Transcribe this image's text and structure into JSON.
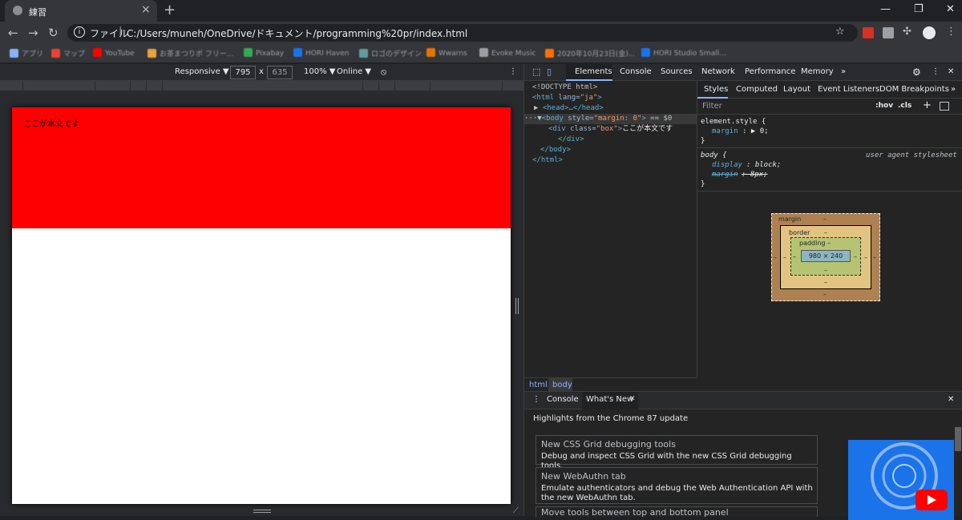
{
  "browser": {
    "tab_title": "練習",
    "new_tab": "+",
    "win_min": "—",
    "win_max": "❐",
    "win_close": "✕",
    "url_scheme": "ファイル",
    "url_separator": "|",
    "url": "C:/Users/muneh/OneDrive/ドキュメント/programming%20pr/index.html",
    "bookmarks": [
      {
        "label": "アプリ",
        "color": "#8ab4f8"
      },
      {
        "label": "マップ",
        "color": "#ea4335"
      },
      {
        "label": "YouTube",
        "color": "#ff0000"
      },
      {
        "label": "お茶まつりボ フリー...",
        "color": "#e8a33d"
      },
      {
        "label": "Pixabay",
        "color": "#34a853"
      },
      {
        "label": "HORI Haven",
        "color": "#1a73e8"
      },
      {
        "label": "ロゴのデザイン",
        "color": "#5f9ea0"
      },
      {
        "label": "Wwarns",
        "color": "#e37400"
      },
      {
        "label": "Evoke Music",
        "color": "#9aa0a6"
      },
      {
        "label": "2020年10月23日(金)...",
        "color": "#ff6d00"
      },
      {
        "label": "HORI Studio Small...",
        "color": "#1a73e8"
      }
    ]
  },
  "device_toolbar": {
    "device": "Responsive ▼",
    "width": "795",
    "x": "x",
    "height": "635",
    "zoom": "100% ▼",
    "network": "Online ▼"
  },
  "page": {
    "box_text": "ここが本文です",
    "box_color": "#ff0000"
  },
  "devtools": {
    "tabs": [
      "Elements",
      "Console",
      "Sources",
      "Network",
      "Performance",
      "Memory",
      "»"
    ],
    "dom": {
      "doctype": "<!DOCTYPE html>",
      "html_open_tag": "<html",
      "html_lang_attr": "lang=",
      "html_lang_val": "\"ja\"",
      "html_open_close": ">",
      "head": "<head>…</head>",
      "body_tag": "<body",
      "body_attr": "style=",
      "body_val": "\"margin: 0\"",
      "body_close": ">",
      "body_eq": "== $0",
      "div_tag": "<div",
      "div_attr": "class=",
      "div_val": "\"box\"",
      "div_close": ">",
      "div_text": "ここが本文です",
      "div_end": "</div>",
      "body_end": "</body>",
      "html_end": "</html>"
    },
    "breadcrumbs": [
      "html",
      "body"
    ],
    "style_tabs": [
      "Styles",
      "Computed",
      "Layout",
      "Event Listeners",
      "DOM Breakpoints",
      "»"
    ],
    "filter_placeholder": "Filter",
    "hov": ":hov",
    "cls": ".cls",
    "plus": "+",
    "rule1": {
      "selector": "element.style {",
      "prop": "margin",
      "value": "0;",
      "close": "}"
    },
    "rule2": {
      "selector": "body {",
      "source": "user agent stylesheet",
      "prop1": "display",
      "val1": "block;",
      "prop2": "margin",
      "val2": "8px;",
      "close": "}"
    },
    "box_model": {
      "margin_label": "margin",
      "margin_top": "–",
      "margin_bottom": "–",
      "margin_left": "–",
      "margin_right": "–",
      "border_label": "border",
      "border_top": "–",
      "border_bottom": "–",
      "border_left": "–",
      "border_right": "–",
      "padding_label": "padding –",
      "padding_bottom": "–",
      "padding_left": "–",
      "padding_right": "–",
      "content": "980 × 240"
    }
  },
  "drawer": {
    "tabs": [
      "Console",
      "What's New"
    ],
    "close": "✕",
    "heading": "Highlights from the Chrome 87 update",
    "cards": [
      {
        "title": "New CSS Grid debugging tools",
        "desc": "Debug and inspect CSS Grid with the new CSS Grid debugging tools."
      },
      {
        "title": "New WebAuthn tab",
        "desc": "Emulate authenticators and debug the Web Authentication API with the new WebAuthn tab."
      },
      {
        "title": "Move tools between top and bottom panel",
        "desc": ""
      }
    ]
  }
}
